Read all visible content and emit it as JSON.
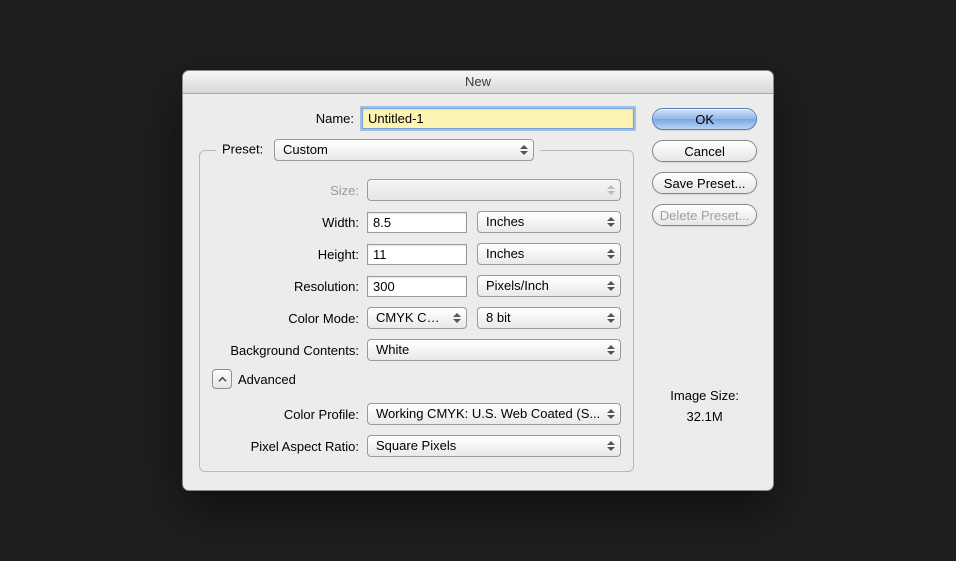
{
  "title": "New",
  "labels": {
    "name": "Name:",
    "preset": "Preset:",
    "size": "Size:",
    "width": "Width:",
    "height": "Height:",
    "resolution": "Resolution:",
    "colorMode": "Color Mode:",
    "bgContents": "Background Contents:",
    "advanced": "Advanced",
    "colorProfile": "Color Profile:",
    "pixelAspect": "Pixel Aspect Ratio:",
    "imageSize": "Image Size:"
  },
  "values": {
    "name": "Untitled-1",
    "preset": "Custom",
    "size": "",
    "width": "8.5",
    "widthUnit": "Inches",
    "height": "11",
    "heightUnit": "Inches",
    "resolution": "300",
    "resolutionUnit": "Pixels/Inch",
    "colorMode": "CMYK Color",
    "bitDepth": "8 bit",
    "bgContents": "White",
    "colorProfile": "Working CMYK:  U.S. Web Coated (S...",
    "pixelAspect": "Square Pixels",
    "imageSize": "32.1M"
  },
  "buttons": {
    "ok": "OK",
    "cancel": "Cancel",
    "savePreset": "Save Preset...",
    "deletePreset": "Delete Preset..."
  }
}
